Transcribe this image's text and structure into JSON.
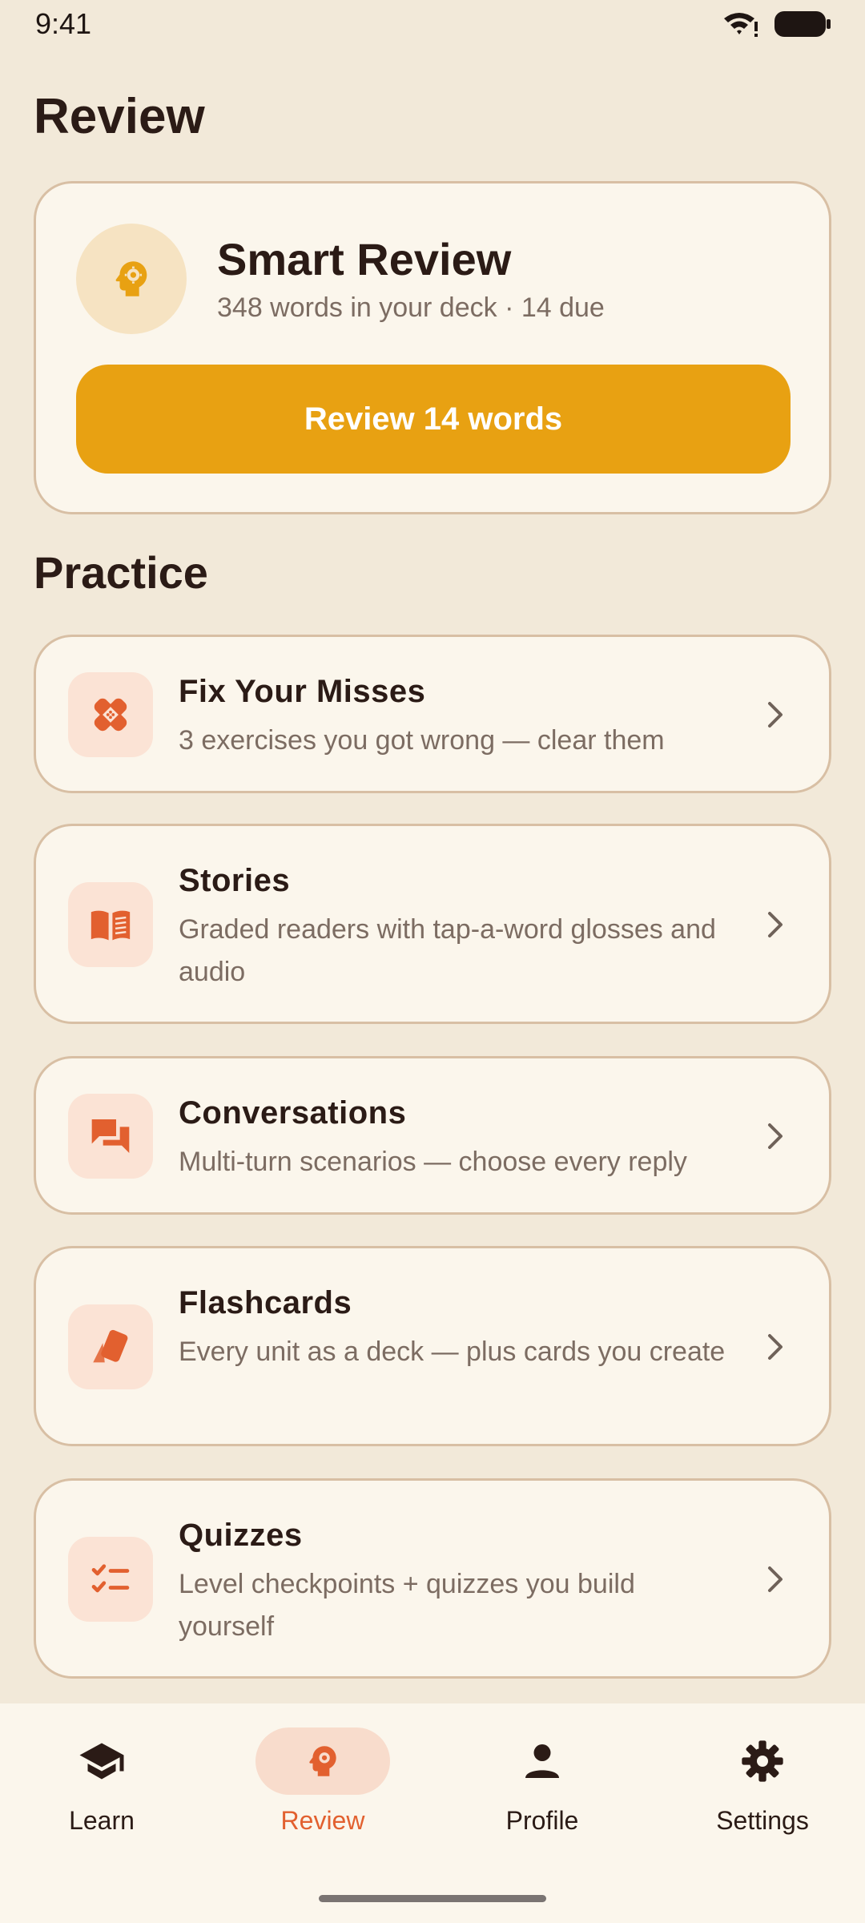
{
  "status_bar": {
    "time": "9:41"
  },
  "page_title": "Review",
  "smart_review": {
    "title": "Smart Review",
    "subtitle": "348 words in your deck · 14 due",
    "button_label": "Review 14 words",
    "icon": "brain-head-icon"
  },
  "practice": {
    "title": "Practice",
    "items": [
      {
        "title": "Fix Your Misses",
        "subtitle": "3 exercises you got wrong — clear them",
        "icon": "bandage-icon"
      },
      {
        "title": "Stories",
        "subtitle": "Graded readers with tap-a-word glosses and audio",
        "icon": "book-icon"
      },
      {
        "title": "Conversations",
        "subtitle": "Multi-turn scenarios — choose every reply",
        "icon": "chat-bubbles-icon"
      },
      {
        "title": "Flashcards",
        "subtitle": "Every unit as a deck — plus cards you create",
        "icon": "cards-icon"
      },
      {
        "title": "Quizzes",
        "subtitle": "Level checkpoints + quizzes you build yourself",
        "icon": "checklist-icon"
      }
    ]
  },
  "nav": {
    "items": [
      {
        "label": "Learn",
        "icon": "graduation-cap-icon",
        "active": false
      },
      {
        "label": "Review",
        "icon": "brain-head-icon",
        "active": true
      },
      {
        "label": "Profile",
        "icon": "person-icon",
        "active": false
      },
      {
        "label": "Settings",
        "icon": "gear-icon",
        "active": false
      }
    ]
  },
  "colors": {
    "background": "#F2E9D9",
    "card": "#FBF6EC",
    "accent_orange": "#E2602F",
    "accent_amber": "#E8A112"
  }
}
